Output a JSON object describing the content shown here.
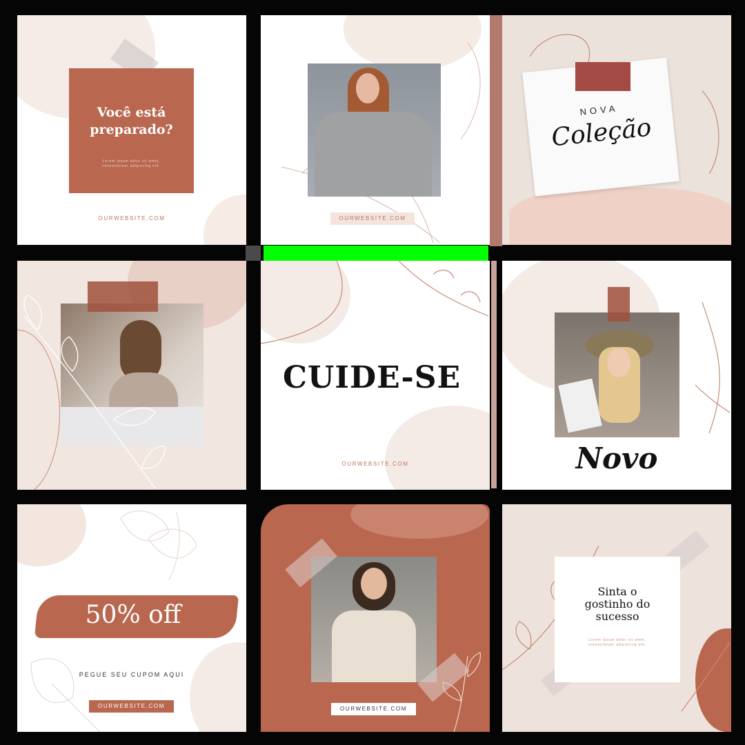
{
  "tiles": {
    "t1": {
      "heading": "Você está\npreparado?",
      "lorem": "Lorem ipsum dolor sit amet,\nconsectetuer adipiscing elit.",
      "website": "OURWEBSITE.COM"
    },
    "t2": {
      "website": "OURWEBSITE.COM"
    },
    "t3": {
      "small": "NOVA",
      "script": "Coleção"
    },
    "t5": {
      "heading": "CUIDE-SE",
      "website": "OURWEBSITE.COM"
    },
    "t6": {
      "script": "Novo"
    },
    "t7": {
      "headline": "50% off",
      "subtext": "PEGUE SEU CUPOM AQUI",
      "website": "OURWEBSITE.COM"
    },
    "t8": {
      "website": "OURWEBSITE.COM"
    },
    "t9": {
      "heading": "Sinta o\ngostinho do\nsucesso",
      "lorem": "Lorem ipsum dolor sit amet,\nconsectetuer adipiscing elit."
    }
  },
  "colors": {
    "terracotta": "#b9674f",
    "blush": "#f1e3dc",
    "cream": "#f8f1ed",
    "rust": "#9c4a3f"
  }
}
